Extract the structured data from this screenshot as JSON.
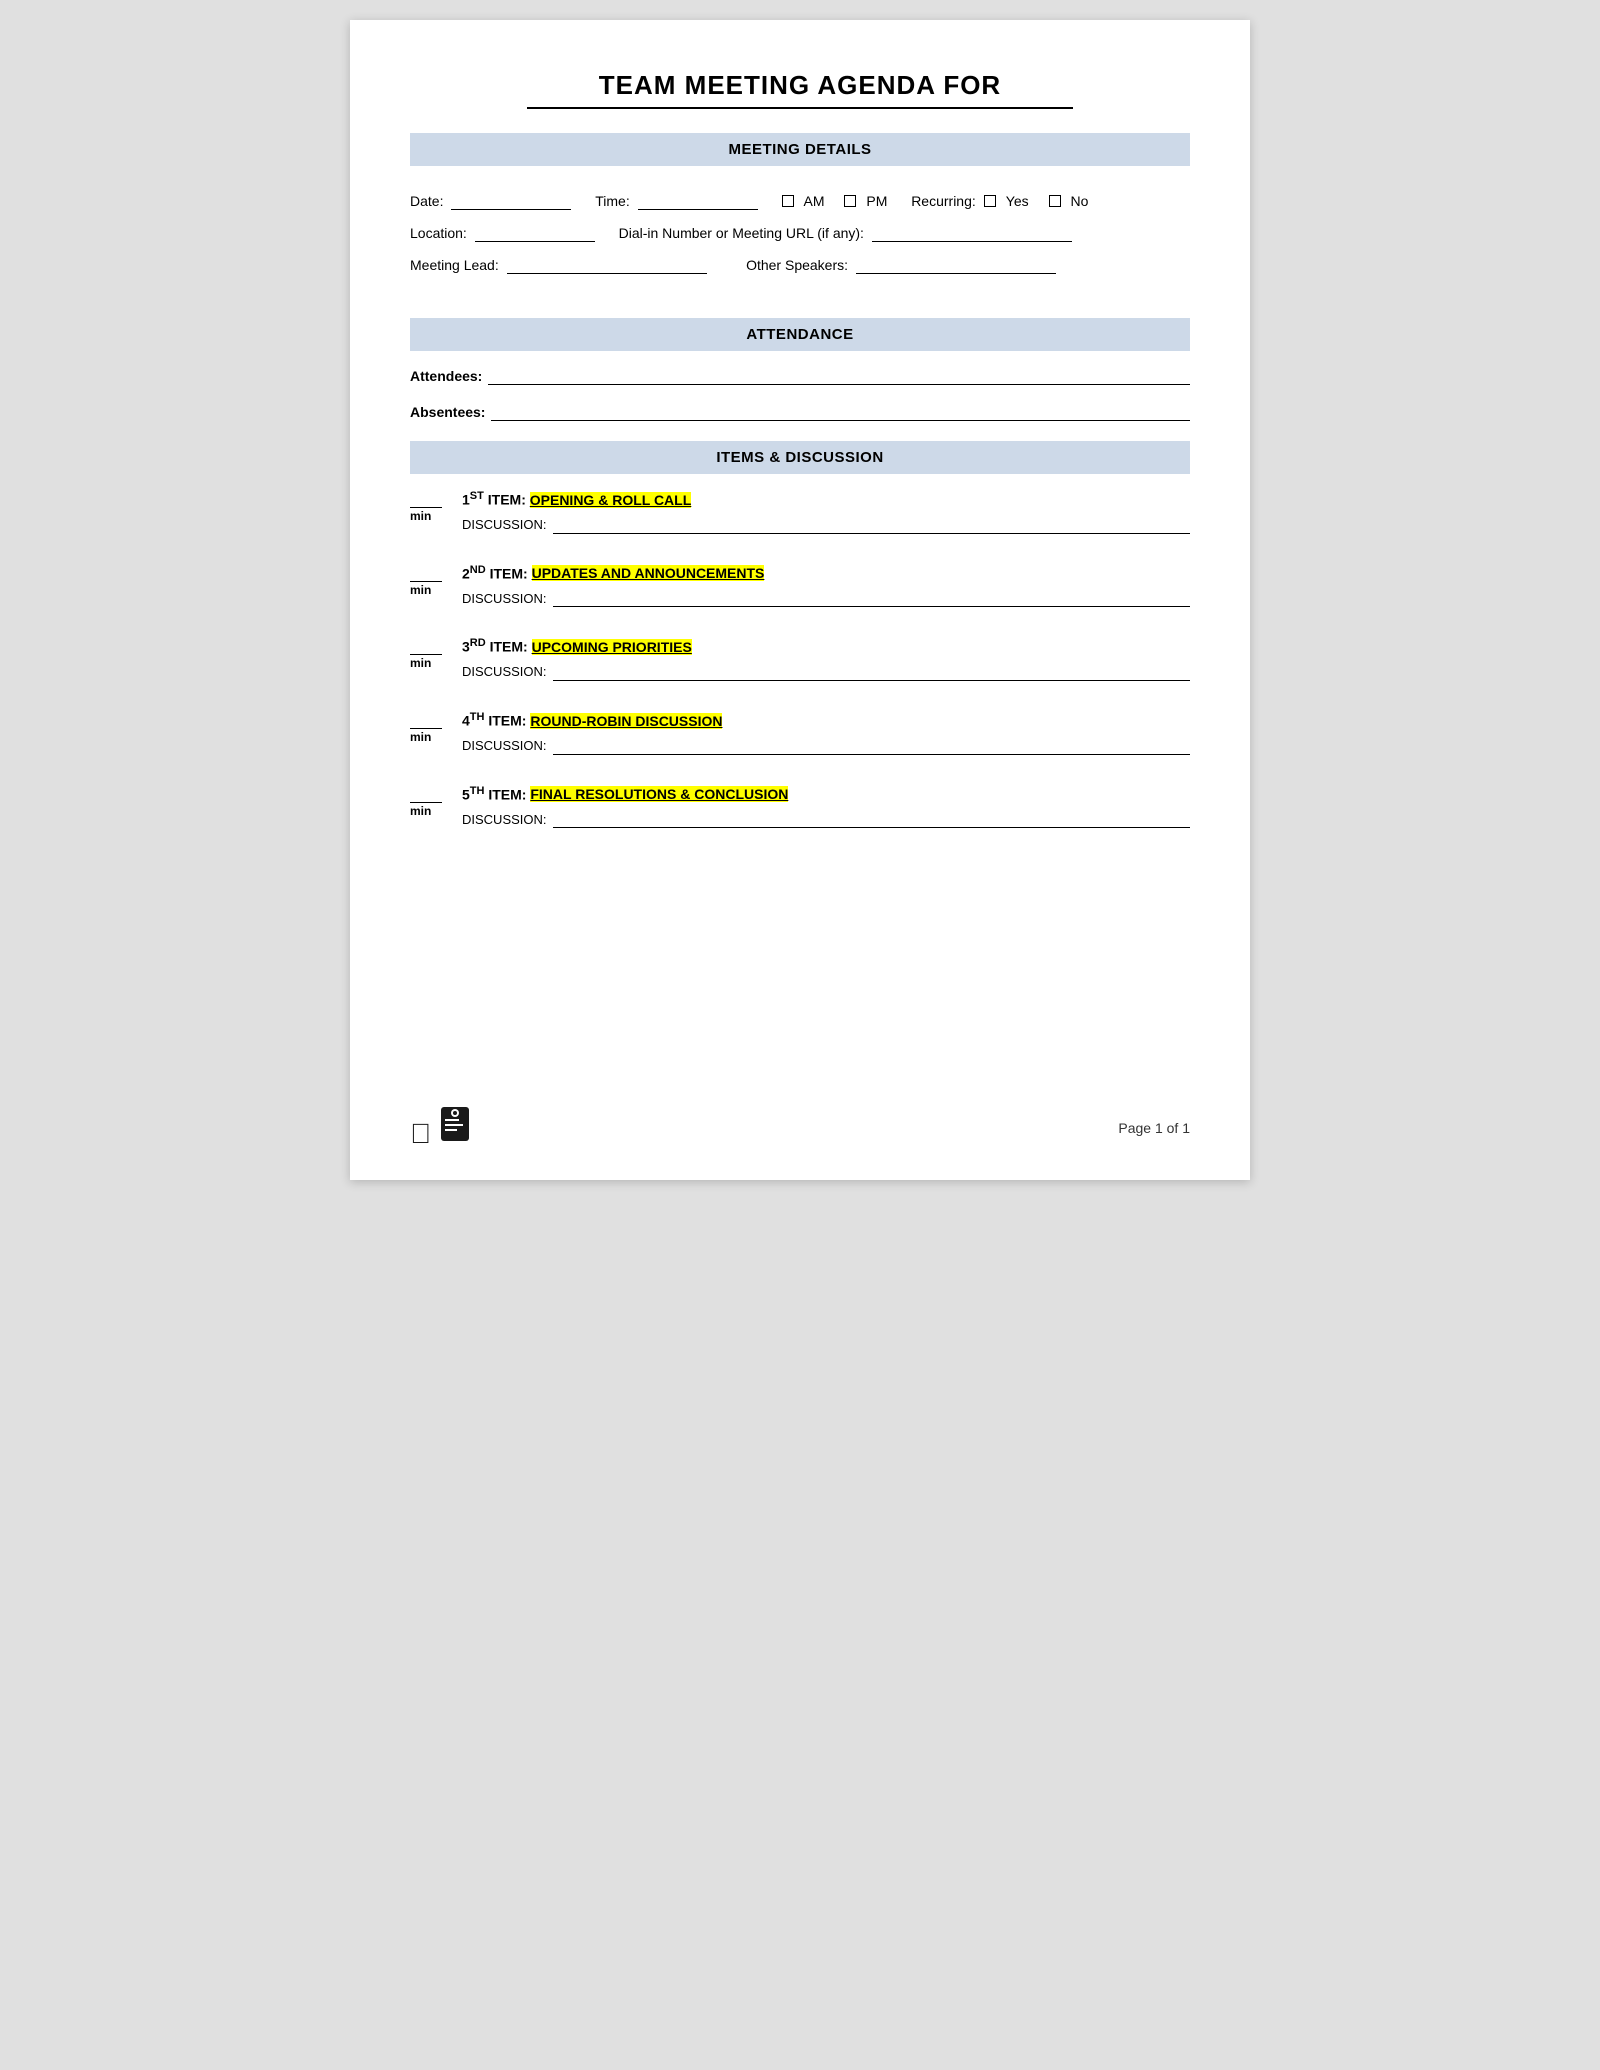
{
  "page": {
    "title": "TEAM MEETING AGENDA FOR",
    "sections": {
      "meeting_details": {
        "header": "MEETING DETAILS",
        "date_label": "Date:",
        "time_label": "Time:",
        "am_label": "AM",
        "pm_label": "PM",
        "recurring_label": "Recurring:",
        "yes_label": "Yes",
        "no_label": "No",
        "location_label": "Location:",
        "dialin_label": "Dial-in Number or Meeting URL (if any):",
        "meeting_lead_label": "Meeting Lead:",
        "other_speakers_label": "Other Speakers:"
      },
      "attendance": {
        "header": "ATTENDANCE",
        "attendees_label": "Attendees:",
        "absentees_label": "Absentees:"
      },
      "items": {
        "header": "ITEMS & DISCUSSION",
        "agenda_items": [
          {
            "number": "1",
            "ordinal": "ST",
            "title": "OPENING & ROLL CALL",
            "discussion_label": "DISCUSSION:"
          },
          {
            "number": "2",
            "ordinal": "ND",
            "title": "UPDATES AND ANNOUNCEMENTS",
            "discussion_label": "DISCUSSION:"
          },
          {
            "number": "3",
            "ordinal": "RD",
            "title": "UPCOMING PRIORITIES",
            "discussion_label": "DISCUSSION:"
          },
          {
            "number": "4",
            "ordinal": "TH",
            "title": "ROUND-ROBIN DISCUSSION",
            "discussion_label": "DISCUSSION:"
          },
          {
            "number": "5",
            "ordinal": "TH",
            "title": "FINAL RESOLUTIONS & CONCLUSION",
            "discussion_label": "DISCUSSION:"
          }
        ]
      }
    },
    "footer": {
      "page_label": "Page 1 of 1"
    }
  }
}
